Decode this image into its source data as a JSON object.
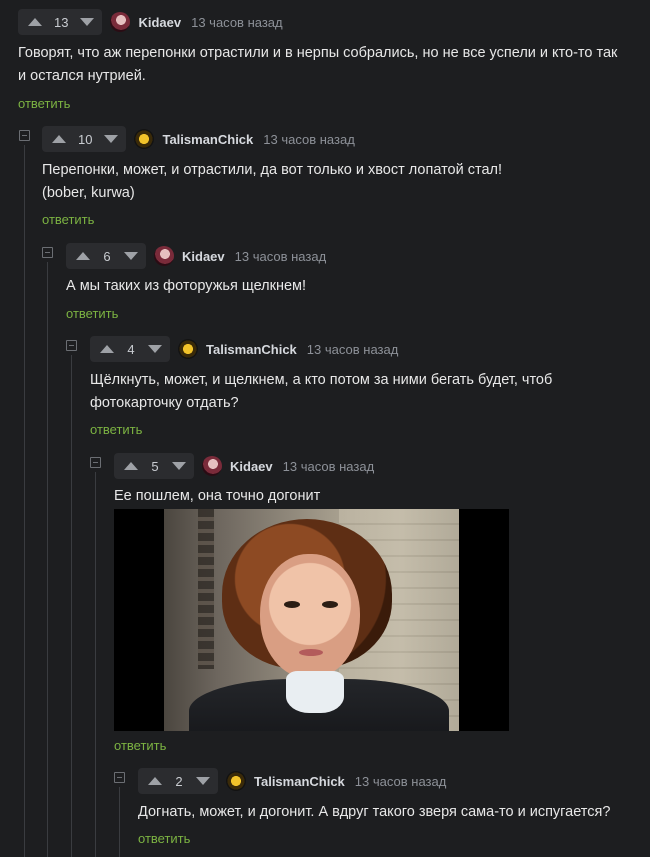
{
  "comments": [
    {
      "score": "13",
      "author": "Kidaev",
      "time": "13 часов назад",
      "text": "Говорят, что аж перепонки отрастили и в нерпы собрались, но не все успели и кто-то так и остался нутрией.",
      "reply": "ответить"
    },
    {
      "score": "10",
      "author": "TalismanChick",
      "time": "13 часов назад",
      "text_line1": "Перепонки, может, и отрастили, да вот только и хвост лопатой стал!",
      "text_line2": "(bober, kurwa)",
      "reply": "ответить"
    },
    {
      "score": "6",
      "author": "Kidaev",
      "time": "13 часов назад",
      "text": "А мы таких из фоторужья щелкнем!",
      "reply": "ответить"
    },
    {
      "score": "4",
      "author": "TalismanChick",
      "time": "13 часов назад",
      "text": "Щёлкнуть, может, и щелкнем, а кто потом за ними бегать будет, чтоб фотокарточку отдать?",
      "reply": "ответить"
    },
    {
      "score": "5",
      "author": "Kidaev",
      "time": "13 часов назад",
      "text": "Ее пошлем, она точно догонит",
      "reply": "ответить"
    },
    {
      "score": "2",
      "author": "TalismanChick",
      "time": "13 часов назад",
      "text": "Догнать, может, и догонит. А вдруг такого зверя сама-то и испугается?",
      "reply": "ответить"
    }
  ],
  "colors": {
    "background": "#1d1e20",
    "reply_link": "#7cb342",
    "thread_line": "#3a3c40"
  }
}
